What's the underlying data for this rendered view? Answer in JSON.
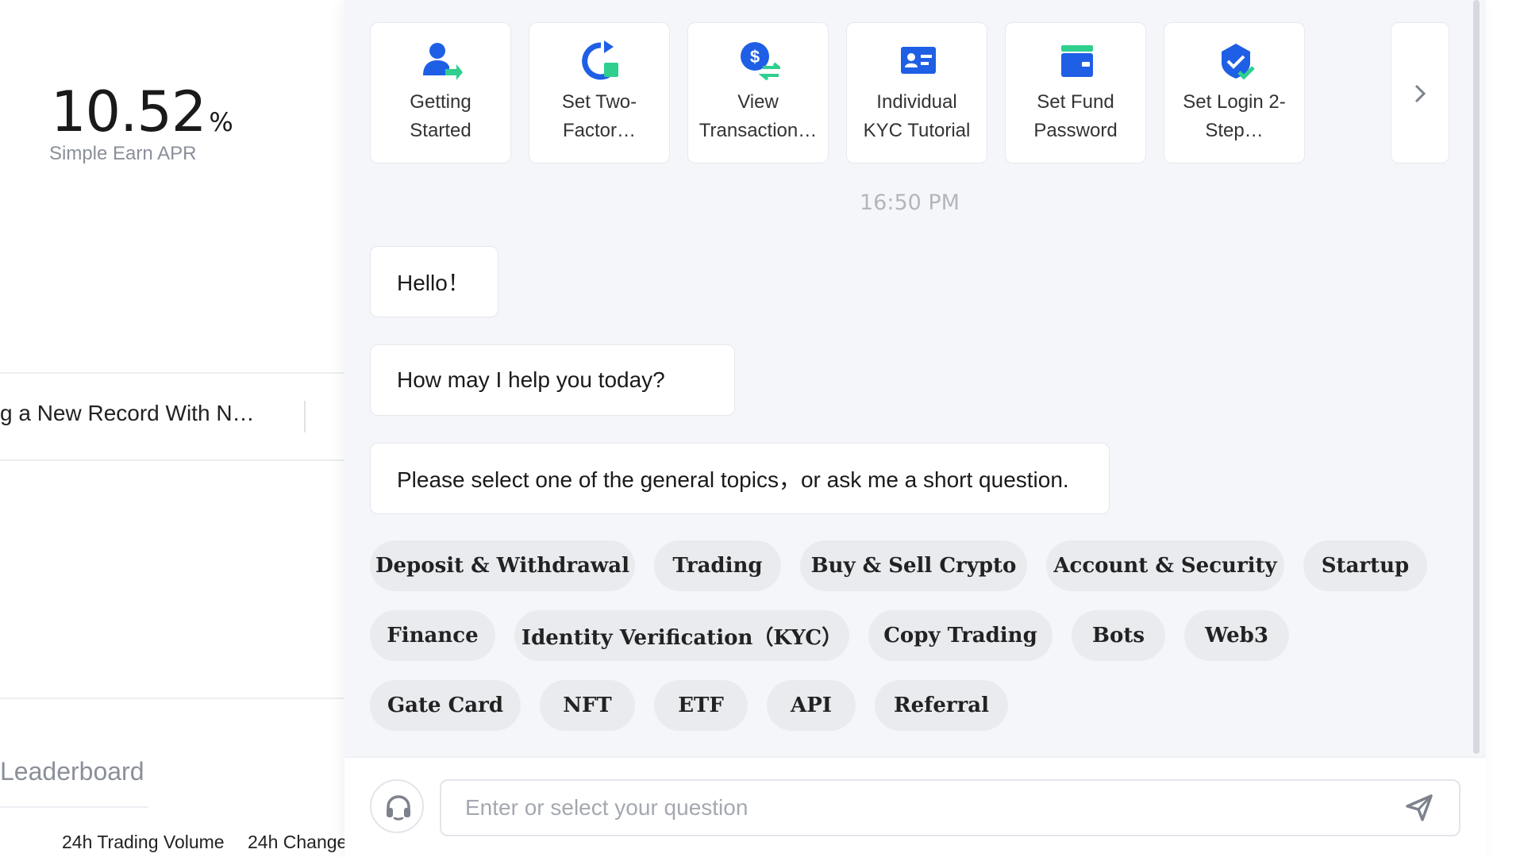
{
  "background_page": {
    "apr_value": "10.52",
    "apr_unit": "%",
    "apr_label": "Simple Earn APR",
    "news_text": "g a New Record With N…",
    "leaderboard_title": "Leaderboard",
    "columns": [
      "24h Trading Volume",
      "24h Change"
    ]
  },
  "quick_cards": [
    {
      "label": "Getting Started",
      "icon": "user-arrow-icon"
    },
    {
      "label": "Set Two-Factor…",
      "icon": "refresh-square-icon"
    },
    {
      "label": "View Transaction…",
      "icon": "dollar-exchange-icon"
    },
    {
      "label": "Individual KYC Tutorial",
      "icon": "id-card-icon"
    },
    {
      "label": "Set Fund Password",
      "icon": "wallet-icon"
    },
    {
      "label": "Set Login 2-Step…",
      "icon": "shield-check-icon"
    }
  ],
  "timestamp": "16:50 PM",
  "messages": [
    "Hello！",
    "How may I help you today?",
    "Please select one of the general topics，or ask me a short question."
  ],
  "topics": [
    [
      "Deposit & Withdrawal",
      "Trading",
      "Buy & Sell Crypto",
      "Account & Security",
      "Startup"
    ],
    [
      "Finance",
      "Identity Verification（KYC）",
      "Copy Trading",
      "Bots",
      "Web3"
    ],
    [
      "Gate Card",
      "NFT",
      "ETF",
      "API",
      "Referral"
    ]
  ],
  "input": {
    "placeholder": "Enter or select your question",
    "value": ""
  },
  "colors": {
    "accent_blue": "#1f5fe6",
    "accent_green": "#2fcf8f",
    "chat_bg": "#f5f6fa",
    "chip_bg": "#e9ebef"
  }
}
